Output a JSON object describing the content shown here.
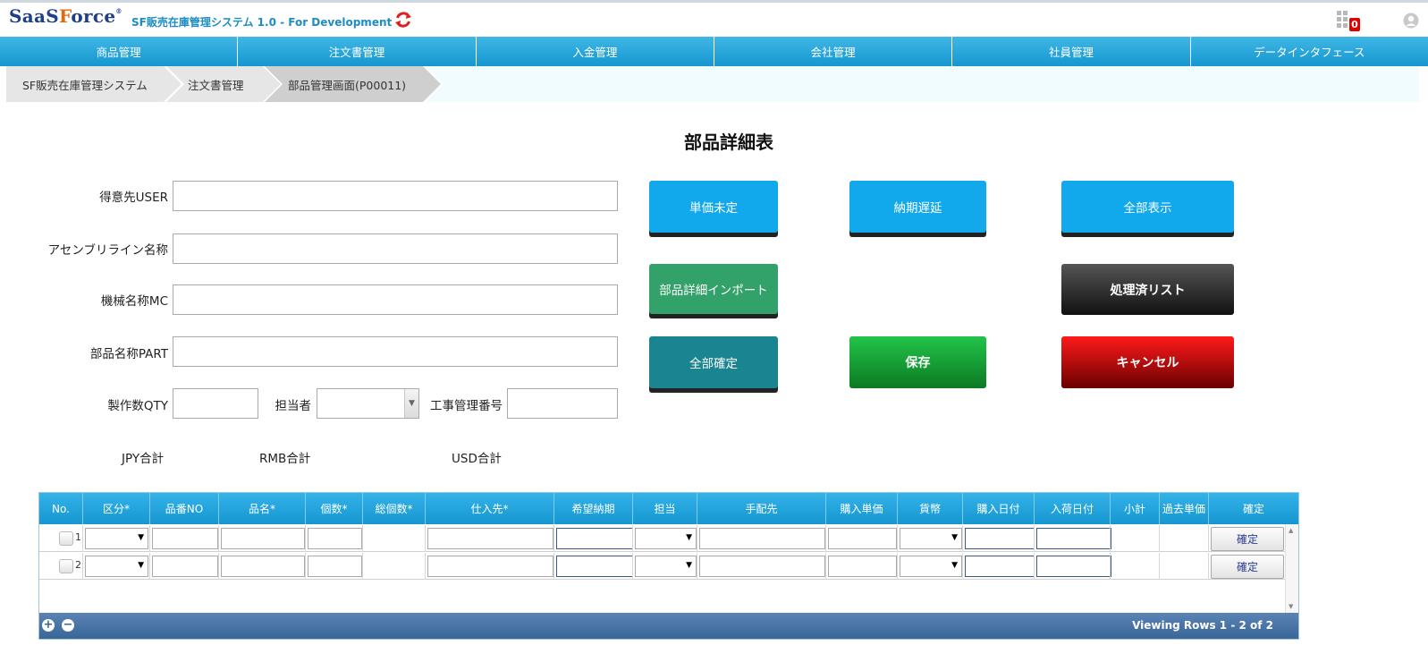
{
  "header": {
    "logo_main": "SaaS",
    "logo_accent": "F",
    "logo_rest": "orce",
    "logo_mark": "®",
    "system_title": "SF販売在庫管理システム 1.0 - For Development",
    "notification_count": "0",
    "icons": {
      "refresh": "refresh-icon",
      "apps": "apps-grid-icon",
      "user": "user-icon"
    },
    "colors": {
      "logo": "#1e3f8a",
      "logo_accent": "#e06a14",
      "title": "#1c8dc5",
      "refresh": "#e02020"
    }
  },
  "nav": {
    "items": [
      "商品管理",
      "注文書管理",
      "入金管理",
      "会社管理",
      "社員管理",
      "データインタフェース"
    ]
  },
  "breadcrumb": {
    "items": [
      "SF販売在庫管理システム",
      "注文書管理",
      "部品管理画面(P00011)"
    ]
  },
  "page": {
    "title": "部品詳細表"
  },
  "form": {
    "customer_label": "得意先USER",
    "customer_value": "",
    "assembly_label": "アセンブリライン名称",
    "assembly_value": "",
    "machine_label": "機械名称MC",
    "machine_value": "",
    "part_label": "部品名称PART",
    "part_value": "",
    "qty_label": "製作数QTY",
    "qty_value": "",
    "person_label": "担当者",
    "person_value": "",
    "project_label": "工事管理番号",
    "project_value": ""
  },
  "buttons": {
    "price_undecided": "単価未定",
    "delivery_delay": "納期遅延",
    "show_all": "全部表示",
    "import_parts": "部品詳細インポート",
    "processed_list": "処理済リスト",
    "confirm_all": "全部確定",
    "save": "保存",
    "cancel": "キャンセル"
  },
  "totals": {
    "jpy": "JPY合計",
    "rmb": "RMB合計",
    "usd": "USD合計"
  },
  "grid": {
    "columns": [
      "No.",
      "区分*",
      "品番NO",
      "品名*",
      "個数*",
      "総個数*",
      "仕入先*",
      "希望納期",
      "担当",
      "手配先",
      "購入単価",
      "貨幣",
      "購入日付",
      "入荷日付",
      "小計",
      "過去単価",
      "確定"
    ],
    "rows": [
      {
        "no": "1",
        "confirm": "確定"
      },
      {
        "no": "2",
        "confirm": "確定"
      }
    ],
    "select_arrow": "▼",
    "pager": "Viewing Rows 1 - 2 of 2",
    "add_symbol": "+",
    "remove_symbol": "−",
    "colors": {
      "header": "#1a9fd6",
      "footer": "#3a6598"
    }
  }
}
